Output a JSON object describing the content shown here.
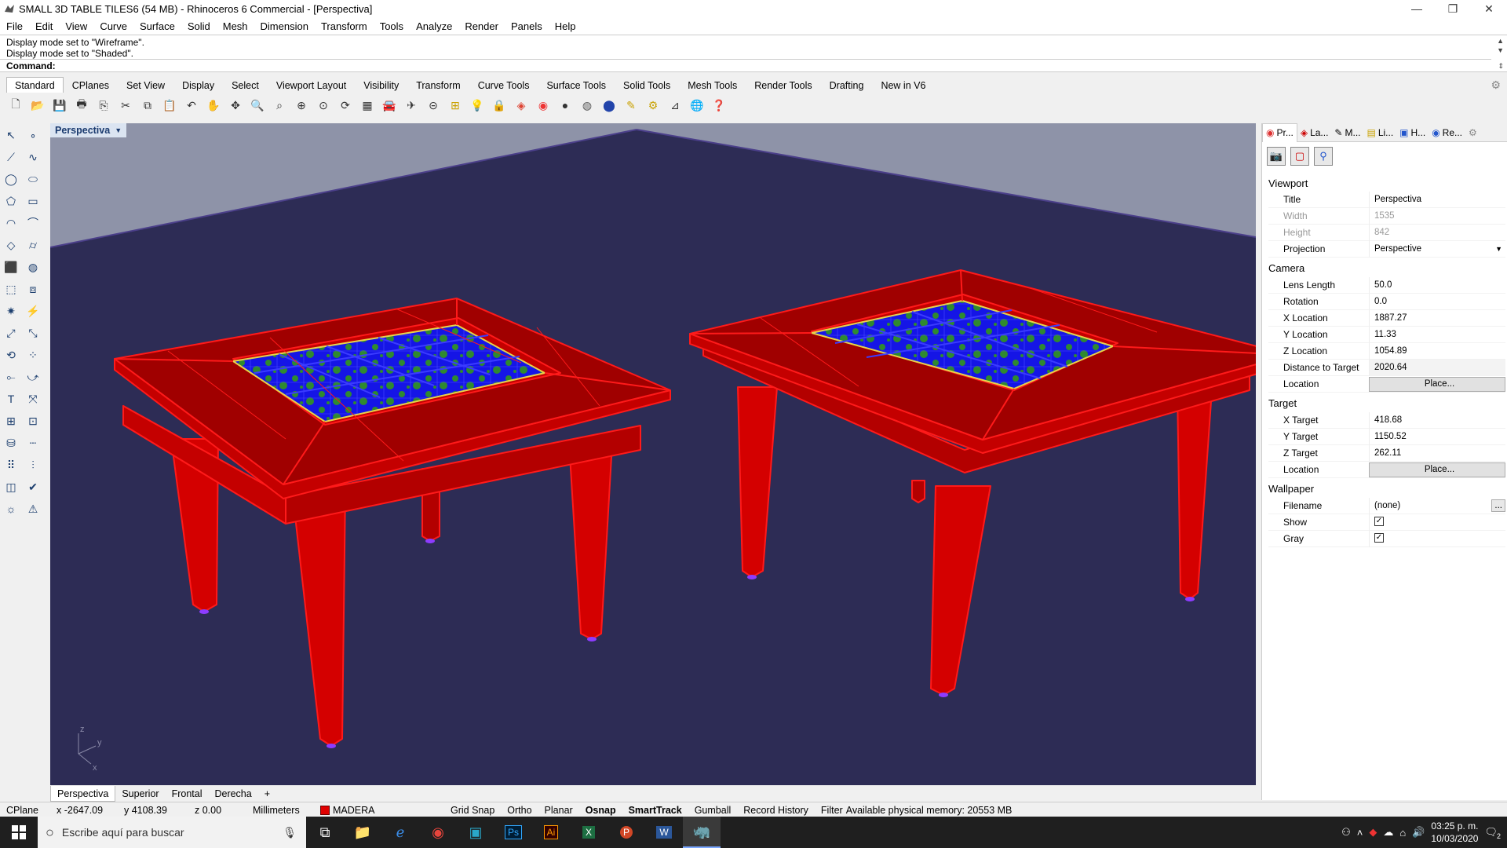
{
  "window": {
    "title": "SMALL 3D TABLE TILES6 (54 MB) - Rhinoceros 6 Commercial - [Perspectiva]",
    "controls": [
      "—",
      "❐",
      "✕"
    ]
  },
  "menu": [
    "File",
    "Edit",
    "View",
    "Curve",
    "Surface",
    "Solid",
    "Mesh",
    "Dimension",
    "Transform",
    "Tools",
    "Analyze",
    "Render",
    "Panels",
    "Help"
  ],
  "command_history": {
    "lines": [
      "Display mode set to \"Wireframe\".",
      "Display mode set to \"Shaded\"."
    ],
    "prompt": "Command:"
  },
  "toolbar_tabs": [
    "Standard",
    "CPlanes",
    "Set View",
    "Display",
    "Select",
    "Viewport Layout",
    "Visibility",
    "Transform",
    "Curve Tools",
    "Surface Tools",
    "Solid Tools",
    "Mesh Tools",
    "Render Tools",
    "Drafting",
    "New in V6"
  ],
  "toolbar_icons": [
    "new-icon",
    "open-icon",
    "save-icon",
    "print-icon",
    "import-icon",
    "cut-icon",
    "copy-icon",
    "paste-icon",
    "undo-icon",
    "pan-icon",
    "rotate-icon",
    "zoom-icon",
    "zoom-window-icon",
    "zoom-extents-icon",
    "zoom-selected-icon",
    "rotate-view-icon",
    "grid-icon",
    "car-icon",
    "plane-icon",
    "snap-icon",
    "cplane-icon",
    "light-icon",
    "lock-icon",
    "layer-icon",
    "color-wheel-icon",
    "render-icon",
    "material-icon",
    "sphere-icon",
    "select-icon",
    "settings-icon",
    "dimension-icon",
    "globe-icon",
    "help-icon"
  ],
  "left_tools": [
    "select-arrow-icon",
    "point-icon",
    "polyline-icon",
    "curve-icon",
    "circle-icon",
    "ellipse-icon",
    "polygon-icon",
    "rectangle-icon",
    "arc-icon",
    "fillet-icon",
    "surface-icon",
    "loft-icon",
    "box-icon",
    "boolean-icon",
    "extrude-icon",
    "cap-icon",
    "explode-icon",
    "split-icon",
    "move-icon",
    "scale-icon",
    "rotate-icon",
    "array-icon",
    "mirror-icon",
    "join-icon",
    "text-icon",
    "dim-icon",
    "group-icon",
    "block-icon",
    "cylinder-icon",
    "line-icon",
    "grid-array-icon",
    "align-icon",
    "shade-icon",
    "check-icon",
    "sun-icon",
    "paint-icon"
  ],
  "viewport": {
    "title": "Perspectiva",
    "tabs": [
      "Perspectiva",
      "Superior",
      "Frontal",
      "Derecha"
    ],
    "add_tab": "+",
    "axes": {
      "x": "x",
      "y": "y",
      "z": "z"
    }
  },
  "panel": {
    "tabs": [
      "Pr...",
      "La...",
      "M...",
      "Li...",
      "H...",
      "Re..."
    ],
    "sections": {
      "viewport": {
        "heading": "Viewport",
        "title_label": "Title",
        "title_value": "Perspectiva",
        "width_label": "Width",
        "width_value": "1535",
        "height_label": "Height",
        "height_value": "842",
        "projection_label": "Projection",
        "projection_value": "Perspective"
      },
      "camera": {
        "heading": "Camera",
        "lens_label": "Lens Length",
        "lens_value": "50.0",
        "rotation_label": "Rotation",
        "rotation_value": "0.0",
        "x_label": "X Location",
        "x_value": "1887.27",
        "y_label": "Y Location",
        "y_value": "11.33",
        "z_label": "Z Location",
        "z_value": "1054.89",
        "dist_label": "Distance to Target",
        "dist_value": "2020.64",
        "location_label": "Location",
        "place_button": "Place..."
      },
      "target": {
        "heading": "Target",
        "x_label": "X Target",
        "x_value": "418.68",
        "y_label": "Y Target",
        "y_value": "1150.52",
        "z_label": "Z Target",
        "z_value": "262.11",
        "location_label": "Location",
        "place_button": "Place..."
      },
      "wallpaper": {
        "heading": "Wallpaper",
        "filename_label": "Filename",
        "filename_value": "(none)",
        "browse": "...",
        "show_label": "Show",
        "show_checked": "✓",
        "gray_label": "Gray",
        "gray_checked": "✓"
      }
    }
  },
  "status": {
    "cplane": "CPlane",
    "x": "x -2647.09",
    "y": "y 4108.39",
    "z": "z 0.00",
    "units": "Millimeters",
    "layer": "MADERA",
    "layer_color": "#e00000",
    "grid_snap": "Grid Snap",
    "ortho": "Ortho",
    "planar": "Planar",
    "osnap": "Osnap",
    "smarttrack": "SmartTrack",
    "gumball": "Gumball",
    "record_history": "Record History",
    "filter": "Filter",
    "memory": "Available physical memory: 20553 MB"
  },
  "taskbar": {
    "search_placeholder": "Escribe aquí para buscar",
    "apps": [
      "task-view-icon",
      "file-explorer-icon",
      "edge-icon",
      "chrome-icon",
      "app-icon",
      "photoshop-icon",
      "illustrator-icon",
      "excel-icon",
      "powerpoint-icon",
      "word-icon",
      "rhino-icon"
    ],
    "app_labels": {
      "ps": "Ps",
      "ai": "Ai",
      "x": "X",
      "p": "P",
      "w": "W"
    },
    "time": "03:25 p. m.",
    "date": "10/03/2020",
    "notifications": "2"
  },
  "colors": {
    "viewport_bg": "#2d2c55",
    "table_red": "#d40000",
    "tile_blue": "#1515e6",
    "tile_green": "#2f8a2f"
  }
}
